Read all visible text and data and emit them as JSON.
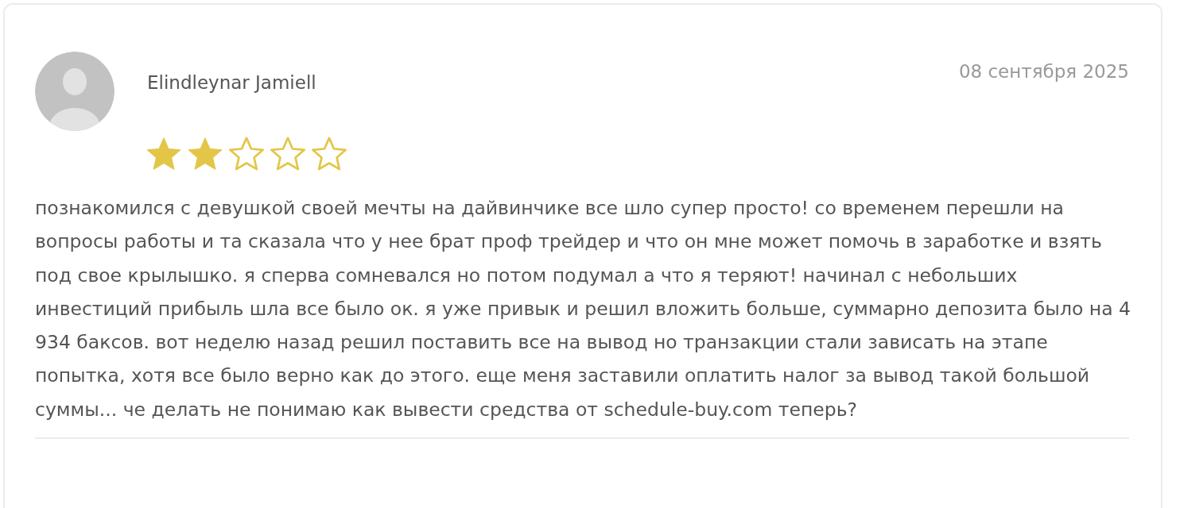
{
  "review": {
    "author": "Elindleynar Jamiell",
    "date": "08 сентября 2025",
    "stars": 2,
    "text": "познакомился с девушкой своей мечты на дайвинчике все шло супер просто! со временем перешли на вопросы работы и та сказала что у нее брат проф трейдер и что он мне может помочь в заработке и взять под свое крылышко. я сперва сомневался но потом подумал а что я теряют! начинал с небольших инвестиций прибыль шла все было ок. я уже привык и решил вложить больше, суммарно депозита было на 4 934 баксов. вот неделю назад решил поставить все на вывод но транзакции стали зависать на этапе попытка, хотя все было верно как до этого. еще меня заставили оплатить налог за вывод такой большой суммы... че делать не понимаю как вывести средства от schedule-buy.com теперь?"
  }
}
